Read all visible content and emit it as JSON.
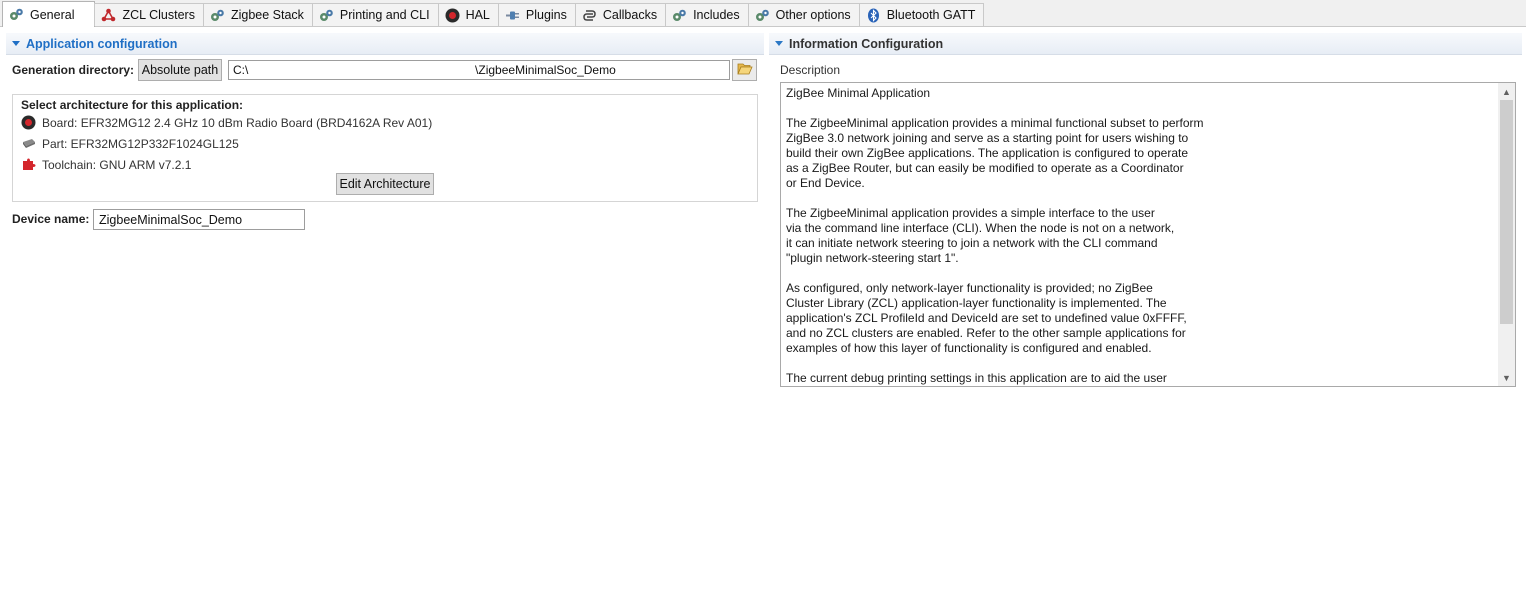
{
  "tabs": [
    {
      "label": "General",
      "icon": "gears-icon",
      "active": true
    },
    {
      "label": "ZCL Clusters",
      "icon": "cluster-nodes-icon"
    },
    {
      "label": "Zigbee Stack",
      "icon": "gears-icon"
    },
    {
      "label": "Printing and CLI",
      "icon": "gears-icon"
    },
    {
      "label": "HAL",
      "icon": "hal-chip-icon"
    },
    {
      "label": "Plugins",
      "icon": "plug-icon"
    },
    {
      "label": "Callbacks",
      "icon": "callback-icon"
    },
    {
      "label": "Includes",
      "icon": "gears-icon"
    },
    {
      "label": "Other options",
      "icon": "gears-icon"
    },
    {
      "label": "Bluetooth GATT",
      "icon": "bluetooth-icon"
    }
  ],
  "app_config": {
    "header": "Application configuration",
    "generation_label": "Generation directory:",
    "absolute_path_button": "Absolute path",
    "path_value": "C:\\                                                                    \\ZigbeeMinimalSoc_Demo",
    "arch_title": "Select architecture for this application:",
    "board": "Board: EFR32MG12 2.4 GHz 10 dBm Radio Board (BRD4162A Rev A01)",
    "part": "Part: EFR32MG12P332F1024GL125",
    "toolchain": "Toolchain: GNU ARM v7.2.1",
    "edit_button": "Edit Architecture",
    "device_label": "Device name:",
    "device_value": "ZigbeeMinimalSoc_Demo"
  },
  "info_config": {
    "header": "Information Configuration",
    "description_label": "Description",
    "description_text": "ZigBee Minimal Application\n\nThe ZigbeeMinimal application provides a minimal functional subset to perform\nZigBee 3.0 network joining and serve as a starting point for users wishing to\nbuild their own ZigBee applications. The application is configured to operate\nas a ZigBee Router, but can easily be modified to operate as a Coordinator\nor End Device.\n\nThe ZigbeeMinimal application provides a simple interface to the user\nvia the command line interface (CLI). When the node is not on a network,\nit can initiate network steering to join a network with the CLI command\n\"plugin network-steering start 1\".\n\nAs configured, only network-layer functionality is provided; no ZigBee\nCluster Library (ZCL) application-layer functionality is implemented. The\napplication's ZCL ProfileId and DeviceId are set to undefined value 0xFFFF,\nand no ZCL clusters are enabled. Refer to the other sample applications for\nexamples of how this layer of functionality is configured and enabled.\n\nThe current debug printing settings in this application are to aid the user"
  },
  "colors": {
    "accent": "#1f6fc5",
    "tab_bg": "#f0f0f0",
    "button_bg": "#e1e1e1"
  }
}
